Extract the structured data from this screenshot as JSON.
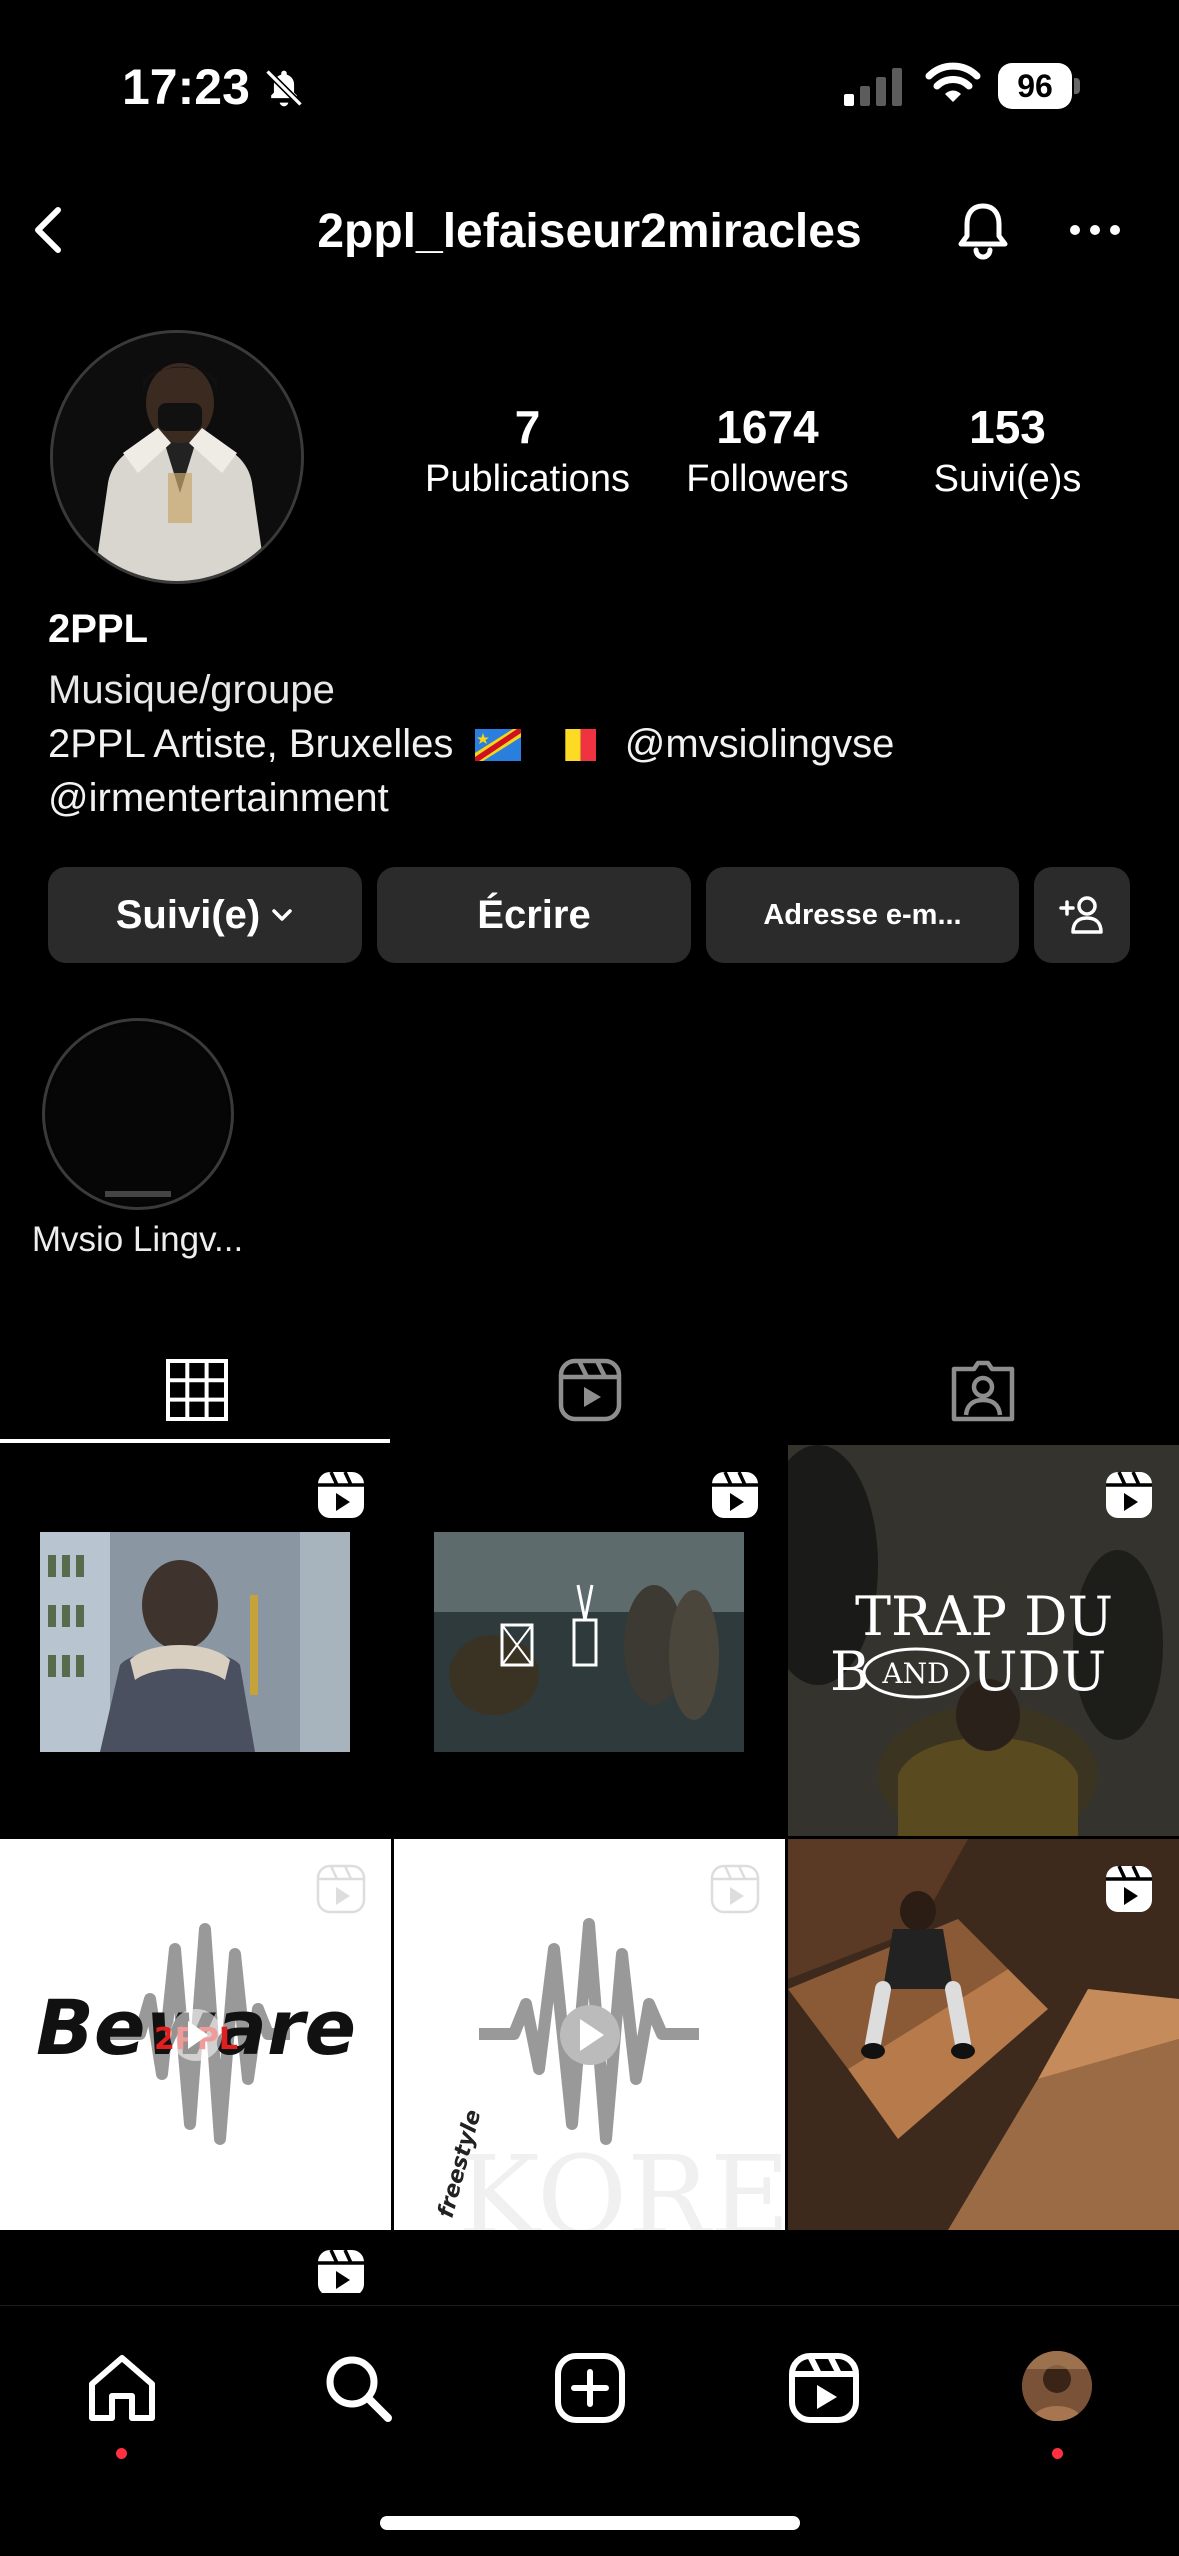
{
  "status_bar": {
    "time": "17:23",
    "battery": "96",
    "icons": [
      "bell-off-icon",
      "cellular-signal-icon",
      "wifi-icon",
      "battery-icon"
    ]
  },
  "header": {
    "username": "2ppl_lefaiseur2miracles",
    "icons": [
      "back-icon",
      "notification-bell-icon",
      "more-options-icon"
    ]
  },
  "profile": {
    "stats": [
      {
        "value": "7",
        "label": "Publications"
      },
      {
        "value": "1674",
        "label": "Followers"
      },
      {
        "value": "153",
        "label": "Suivi(e)s"
      }
    ],
    "name": "2PPL",
    "category": "Musique/groupe",
    "bio_line1_text": "2PPL Artiste, Bruxelles",
    "bio_line1_mention": "@mvsiolingvse",
    "bio_line2": "@irmentertainment",
    "flags": [
      "dr-congo-flag-icon",
      "belgium-flag-icon"
    ]
  },
  "actions": {
    "following": "Suivi(e)",
    "message": "Écrire",
    "email": "Adresse e-m...",
    "add_user_icon": "add-person-icon"
  },
  "highlights": [
    {
      "label": "Mvsio Lingv..."
    }
  ],
  "tabs": [
    "grid-icon",
    "reels-icon",
    "tagged-icon"
  ],
  "grid": {
    "cell3_text_1": "TRAP DU",
    "cell3_text_2": "B",
    "cell3_text_and": "AND",
    "cell3_text_3": "UDU",
    "cell4_text": "Beware",
    "cell4_overlay": "2PPL",
    "cell5_text": "KORE",
    "cell5_side": "freestyle"
  },
  "bottom_nav": [
    "home-icon",
    "search-icon",
    "create-icon",
    "reels-icon",
    "profile-avatar"
  ],
  "colors": {
    "background": "#000000",
    "button_bg": "#2b2b2b",
    "notification_dot": "#ff3040"
  }
}
